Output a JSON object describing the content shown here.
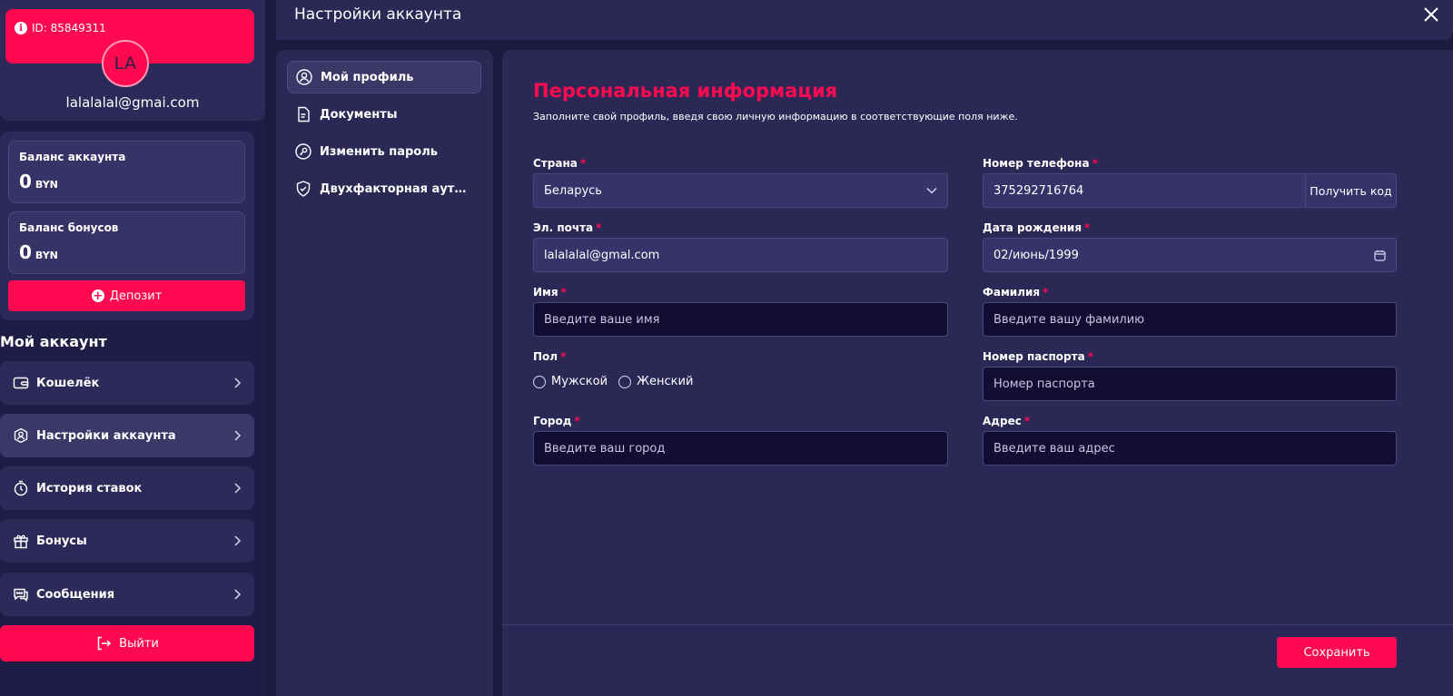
{
  "profile": {
    "id_text": "ID: 85849311",
    "avatar_initials": "LA",
    "email": "lalalalal@gmai.com"
  },
  "balances": {
    "account_label": "Баланс аккаунта",
    "account_amount": "0",
    "account_currency": "BYN",
    "bonus_label": "Баланс бонусов",
    "bonus_amount": "0",
    "bonus_currency": "BYN",
    "deposit_label": "Депозит"
  },
  "sidebar": {
    "section_title": "Мой аккаунт",
    "items": [
      {
        "label": "Кошелёк",
        "icon": "wallet-icon"
      },
      {
        "label": "Настройки аккаунта",
        "icon": "user-shield-icon",
        "active": true
      },
      {
        "label": "История ставок",
        "icon": "history-icon"
      },
      {
        "label": "Бонусы",
        "icon": "gift-icon"
      },
      {
        "label": "Сообщения",
        "icon": "messages-icon"
      }
    ],
    "logout_label": "Выйти"
  },
  "header": {
    "title": "Настройки аккаунта"
  },
  "settings_nav": [
    {
      "label": "Мой профиль",
      "icon": "profile-icon",
      "active": true
    },
    {
      "label": "Документы",
      "icon": "document-icon"
    },
    {
      "label": "Изменить пароль",
      "icon": "key-icon"
    },
    {
      "label": "Двухфакторная аутент...",
      "icon": "shield-check-icon"
    }
  ],
  "form": {
    "title": "Персональная информация",
    "subtitle": "Заполните свой профиль, введя свою личную информацию в соответствующие поля ниже.",
    "country_label": "Страна",
    "country_value": "Беларусь",
    "phone_label": "Номер телефона",
    "phone_value": "375292716764",
    "get_code_label": "Получить код",
    "email_label": "Эл. почта",
    "email_value": "lalalalal@gmal.com",
    "birth_label": "Дата рождения",
    "birth_value": "02/июнь/1999",
    "first_name_label": "Имя",
    "first_name_placeholder": "Введите ваше имя",
    "last_name_label": "Фамилия",
    "last_name_placeholder": "Введите вашу фамилию",
    "gender_label": "Пол",
    "gender_options": [
      "Мужской",
      "Женский"
    ],
    "passport_label": "Номер паспорта",
    "passport_placeholder": "Номер паспорта",
    "city_label": "Город",
    "city_placeholder": "Введите ваш город",
    "address_label": "Адрес",
    "address_placeholder": "Введите ваш адрес",
    "required_mark": "*",
    "save_label": "Сохранить"
  },
  "colors": {
    "accent": "#ff0a50",
    "panel": "#2b2856",
    "input_bg": "#110d33",
    "background": "#1c1a3f"
  }
}
